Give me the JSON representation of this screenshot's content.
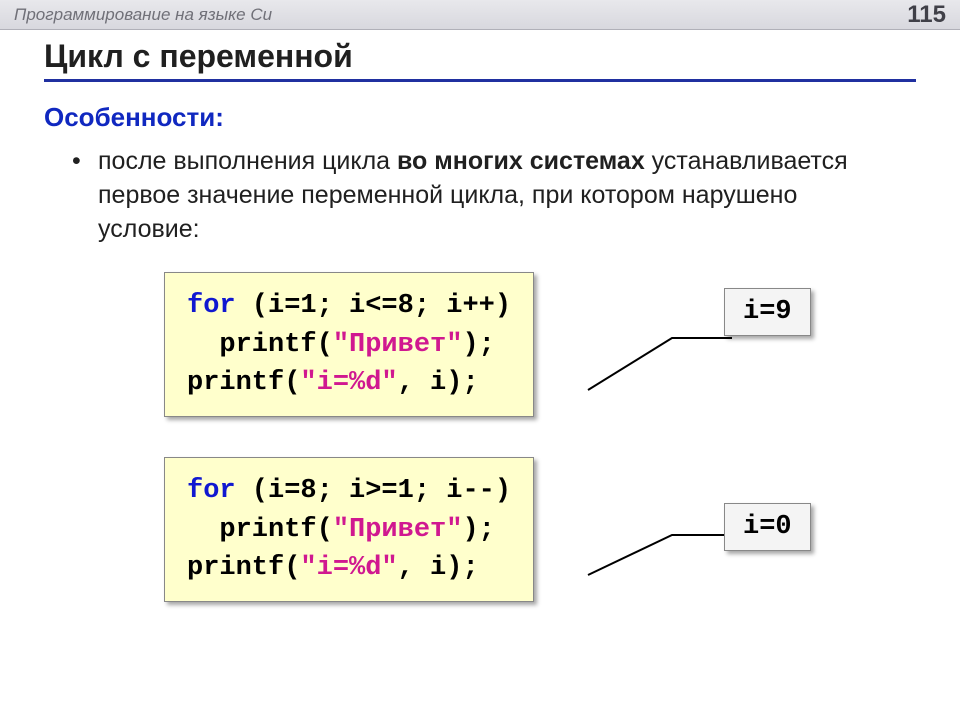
{
  "header": {
    "breadcrumb": "Программирование на языке Си",
    "page": "115"
  },
  "title": "Цикл с переменной",
  "subhead": "Особенности:",
  "bullet": {
    "pre": "после выполнения цикла ",
    "bold": "во многих системах",
    "post": " устанавливается первое значение переменной цикла, при котором нарушено условие:"
  },
  "example1": {
    "kw": "for",
    "cond": " (i=1; i<=8; i++)",
    "indent": "  printf(",
    "str1": "\"Привет\"",
    "after1": ");",
    "line3a": "printf(",
    "str2": "\"i=%d\"",
    "after2": ", i);",
    "result": "i=9"
  },
  "example2": {
    "kw": "for",
    "cond": " (i=8; i>=1; i--)",
    "indent": "  printf(",
    "str1": "\"Привет\"",
    "after1": ");",
    "line3a": "printf(",
    "str2": "\"i=%d\"",
    "after2": ", i);",
    "result": "i=0"
  }
}
